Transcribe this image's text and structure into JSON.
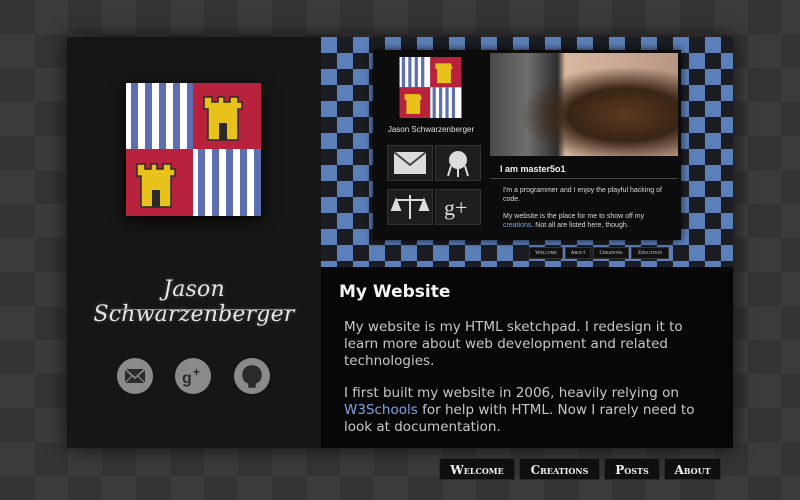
{
  "profile": {
    "name": "Jason Schwarzenberger",
    "social_icons": [
      "mail-icon",
      "google-plus-icon",
      "github-icon"
    ]
  },
  "preview": {
    "name": "Jason Schwarzenberger",
    "heading": "I am master5o1",
    "text_1": "I'm a programmer and I enjoy the playful hacking of code.",
    "text_2a": "My website is the place for me to show off my",
    "text_2_link": "creations",
    "text_2b": ". Not all are listed here, though.",
    "nav": [
      "Welcome",
      "About",
      "Creations",
      "Education"
    ]
  },
  "content": {
    "title": "My Website",
    "paragraph_1": "My website is my HTML sketchpad. I redesign it to learn more about web development and related technologies.",
    "paragraph_2_before": "I first built my website in 2006, heavily relying on",
    "paragraph_2_link": "W3Schools",
    "paragraph_2_after": "for help with HTML. Now I rarely need to look at documentation."
  },
  "nav": {
    "items": [
      "Welcome",
      "Creations",
      "Posts",
      "About"
    ]
  },
  "colors": {
    "crest_red": "#b8223c",
    "crest_stripe": "#5d6fb0",
    "castle_yellow": "#e8c21b",
    "link": "#7fa3e0"
  }
}
